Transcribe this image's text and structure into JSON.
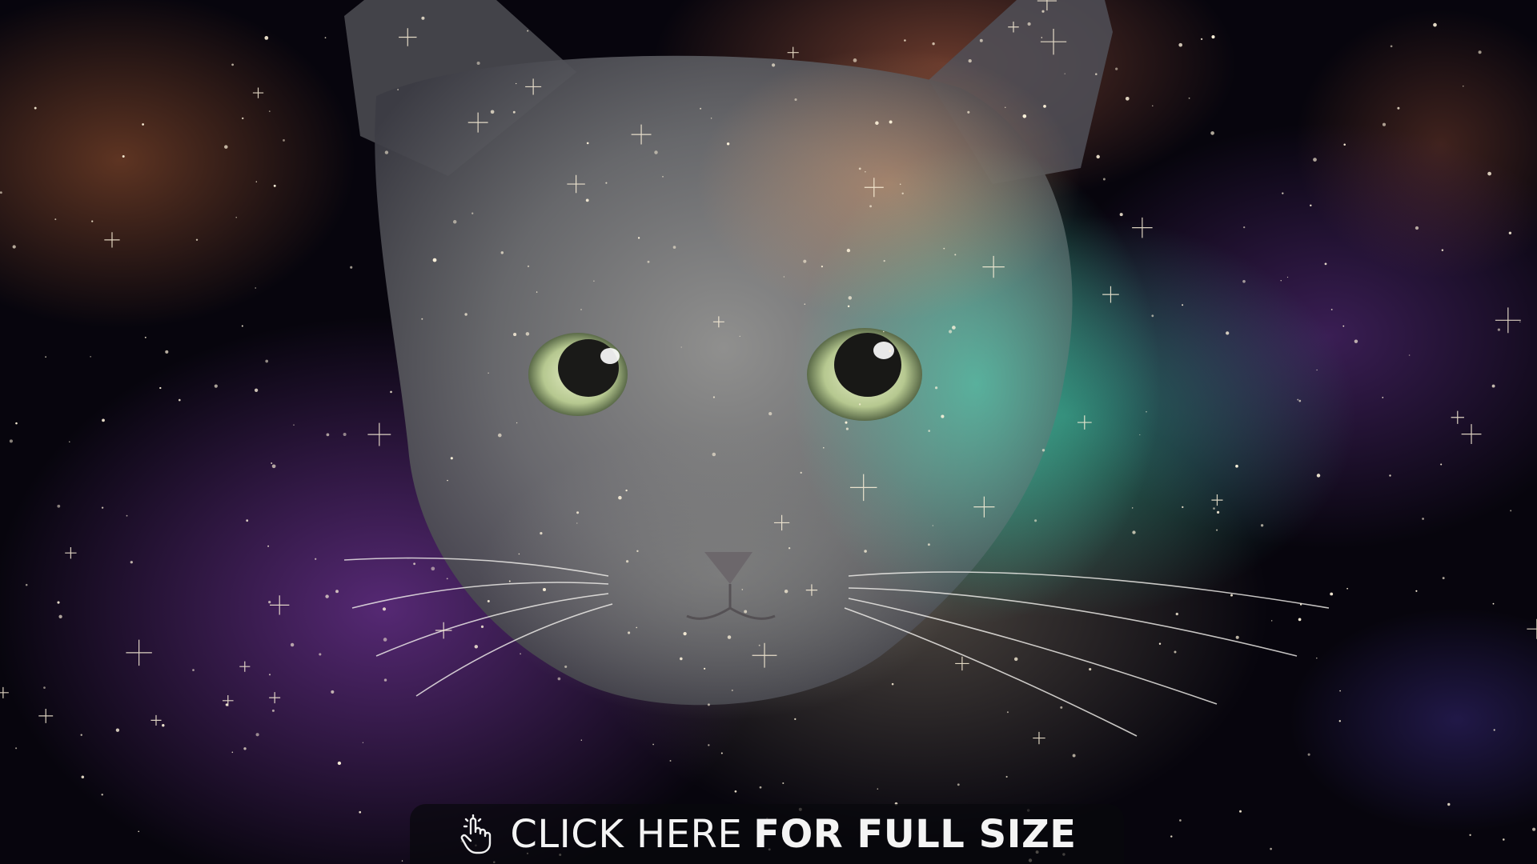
{
  "image": {
    "subject": "cat-in-space",
    "palette": {
      "space": "#07050d",
      "nebula_purple": "#9646c8",
      "nebula_teal": "#3cbea0",
      "nebula_orange": "#dc7850",
      "fur_gray": "#7a7c80",
      "eye_green": "#c8d8a0",
      "star": "#fff4dc"
    }
  },
  "cta": {
    "light_label": "CLICK HERE",
    "bold_label": "FOR FULL SIZE",
    "icon": "pointer-hand-icon",
    "background": "#08080c"
  }
}
